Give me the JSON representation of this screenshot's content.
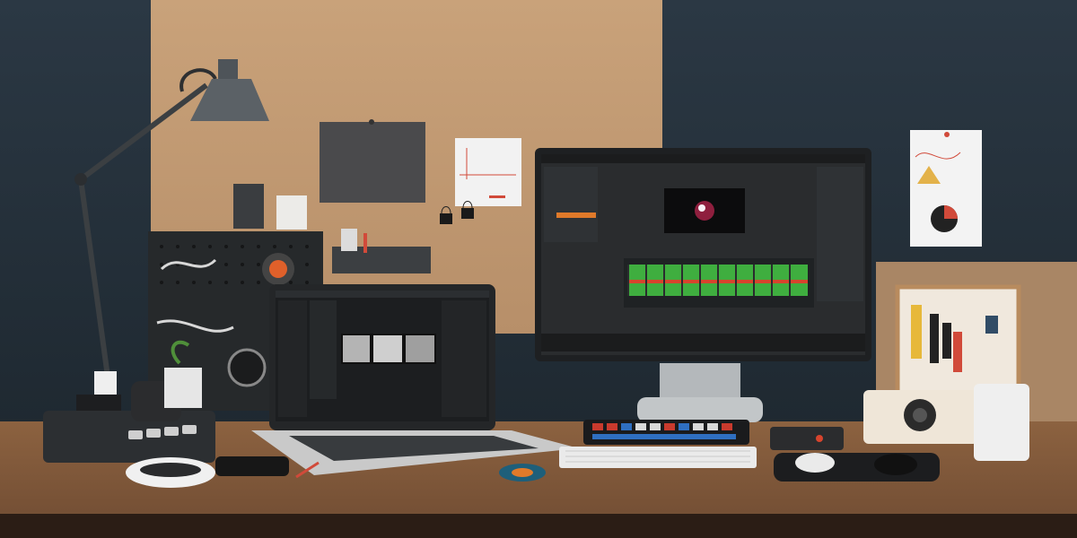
{
  "scene": {
    "description_free": true,
    "monitor_screen": {
      "theme": "dark",
      "accent": "#e07a2a",
      "timeline_clip_color": "#3fae3f",
      "marker_color": "#d7442d"
    },
    "laptop_screen": {
      "theme": "dark"
    },
    "keyboard_key_colors": [
      "#c93a2d",
      "#2f6fc1",
      "#d9d9d9"
    ],
    "lamp_color": "#5b6166"
  }
}
